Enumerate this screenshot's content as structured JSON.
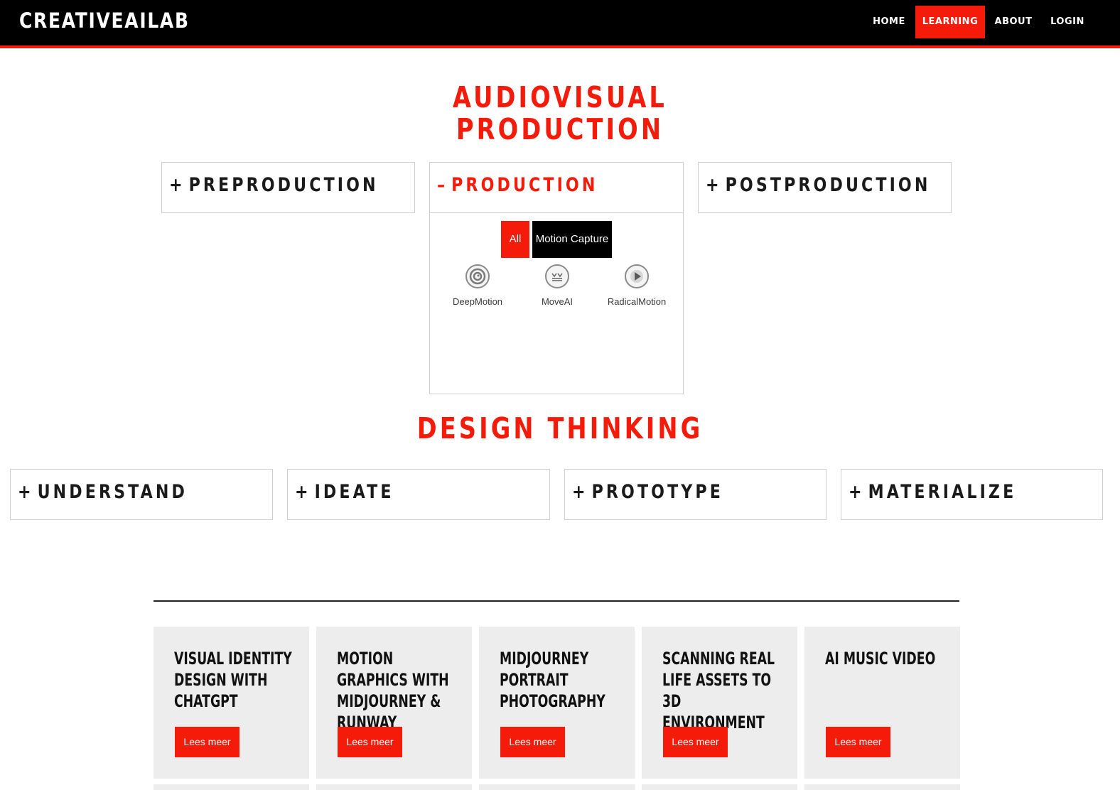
{
  "brand": "CREATIVEAILAB",
  "nav": {
    "home": "HOME",
    "learning": "LEARNING",
    "about": "ABOUT",
    "login": "LOGIN"
  },
  "audiovisual": {
    "title": "AUDIOVISUAL PRODUCTION",
    "sections": [
      {
        "sign": "+",
        "label": "PREPRODUCTION"
      },
      {
        "sign": "–",
        "label": "PRODUCTION"
      },
      {
        "sign": "+",
        "label": "POSTPRODUCTION"
      }
    ],
    "filters": [
      "All",
      "Motion Capture"
    ],
    "tools": [
      "DeepMotion",
      "MoveAI",
      "RadicalMotion"
    ]
  },
  "design_thinking": {
    "title": "DESIGN THINKING",
    "sections": [
      {
        "sign": "+",
        "label": "UNDERSTAND"
      },
      {
        "sign": "+",
        "label": "IDEATE"
      },
      {
        "sign": "+",
        "label": "PROTOTYPE"
      },
      {
        "sign": "+",
        "label": "MATERIALIZE"
      }
    ]
  },
  "cards": [
    {
      "title": "VISUAL IDENTITY DESIGN WITH CHATGPT",
      "button": "Lees meer"
    },
    {
      "title": "MOTION GRAPHICS WITH MIDJOURNEY & RUNWAY",
      "button": "Lees meer"
    },
    {
      "title": "MIDJOURNEY PORTRAIT PHOTOGRAPHY",
      "button": "Lees meer"
    },
    {
      "title": "SCANNING REAL LIFE ASSETS TO 3D ENVIRONMENT",
      "button": "Lees meer"
    },
    {
      "title": "AI MUSIC VIDEO",
      "button": "Lees meer"
    }
  ],
  "colors": {
    "accent": "#f41b0a",
    "nav_bg": "#000000",
    "card_bg": "#ededed"
  }
}
